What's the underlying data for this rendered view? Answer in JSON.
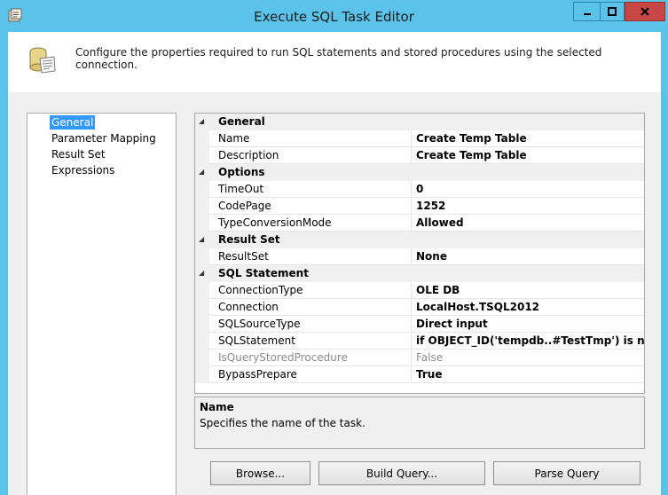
{
  "window": {
    "title": "Execute SQL Task Editor"
  },
  "header": {
    "description": "Configure the properties required to run SQL statements and stored procedures using the selected connection."
  },
  "nav": {
    "items": [
      {
        "label": "General",
        "selected": true
      },
      {
        "label": "Parameter Mapping",
        "selected": false
      },
      {
        "label": "Result Set",
        "selected": false
      },
      {
        "label": "Expressions",
        "selected": false
      }
    ]
  },
  "grid": {
    "rows": [
      {
        "type": "category",
        "label": "General"
      },
      {
        "type": "property",
        "name": "Name",
        "value": "Create Temp Table"
      },
      {
        "type": "property",
        "name": "Description",
        "value": "Create Temp Table"
      },
      {
        "type": "category",
        "label": "Options"
      },
      {
        "type": "property",
        "name": "TimeOut",
        "value": "0"
      },
      {
        "type": "property",
        "name": "CodePage",
        "value": "1252"
      },
      {
        "type": "property",
        "name": "TypeConversionMode",
        "value": "Allowed"
      },
      {
        "type": "category",
        "label": "Result Set"
      },
      {
        "type": "property",
        "name": "ResultSet",
        "value": "None"
      },
      {
        "type": "category",
        "label": "SQL Statement"
      },
      {
        "type": "property",
        "name": "ConnectionType",
        "value": "OLE DB"
      },
      {
        "type": "property",
        "name": "Connection",
        "value": "LocalHost.TSQL2012"
      },
      {
        "type": "property",
        "name": "SQLSourceType",
        "value": "Direct input"
      },
      {
        "type": "property",
        "name": "SQLStatement",
        "value": "if OBJECT_ID('tempdb..#TestTmp') is not nulldr"
      },
      {
        "type": "property",
        "name": "IsQueryStoredProcedure",
        "value": "False",
        "disabled": true
      },
      {
        "type": "property",
        "name": "BypassPrepare",
        "value": "True"
      }
    ]
  },
  "description_panel": {
    "title": "Name",
    "text": "Specifies the name of the task."
  },
  "buttons": {
    "browse": "Browse...",
    "build_query": "Build Query...",
    "parse_query": "Parse Query"
  },
  "icons": {
    "app": "ssis-task-icon",
    "header": "sql-scroll-icon",
    "minimize": "minimize-icon",
    "maximize": "maximize-icon",
    "close": "close-icon",
    "collapse": "collapse-triangle-icon"
  },
  "colors": {
    "titlebar": "#5bc3ea",
    "close_button": "#c74747",
    "selection": "#3399ff"
  }
}
